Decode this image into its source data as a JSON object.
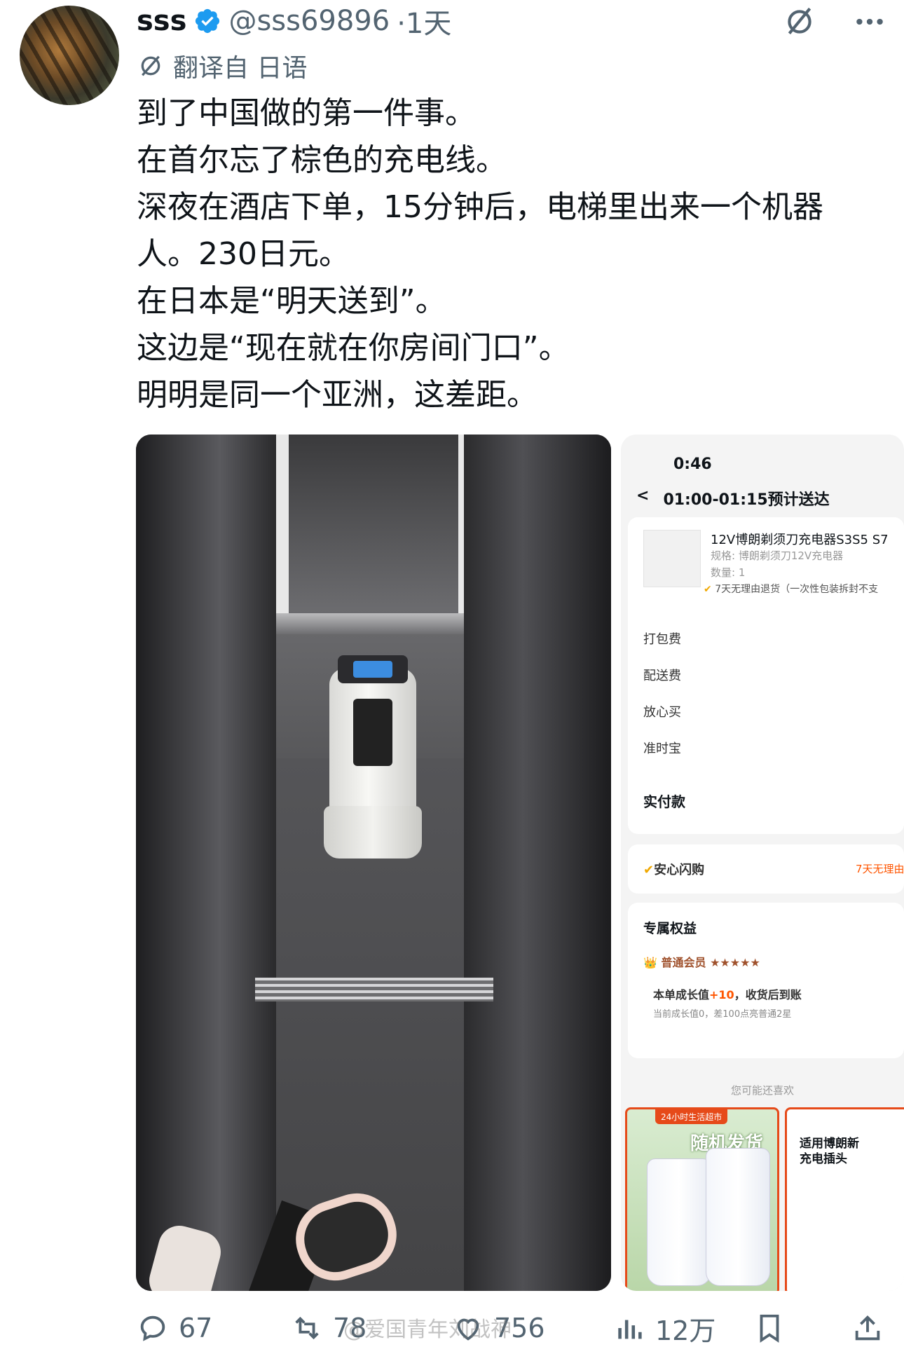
{
  "author": {
    "display_name": "sss",
    "handle": "@sss69896",
    "time": "·1天",
    "verified_icon": "verified-badge-icon"
  },
  "translation_note": "翻译自 日语",
  "tweet_lines": [
    "到了中国做的第一件事。",
    "在首尔忘了棕色的充电线。",
    "深夜在酒店下单，15分钟后，电梯里出来一个机器",
    "人。230日元。",
    "在日本是“明天送到”。",
    "这边是“现在就在你房间门口”。",
    "明明是同一个亚洲，这差距。"
  ],
  "phone": {
    "time": "0:46",
    "eta": "01:00-01:15预计送达",
    "product_title": "12V博朗剃须刀充电器S3S5 S7",
    "product_spec": "规格: 博朗剃须刀12V充电器",
    "product_qty": "数量: 1",
    "return_policy": "7天无理由退货（一次性包装拆封不支",
    "fees": [
      "打包费",
      "配送费",
      "放心买",
      "准时宝"
    ],
    "paid_label": "实付款",
    "safe_buy": "安心闪购",
    "safe_buy_note": "7天无理由",
    "perks_title": "专属权益",
    "member_level": "普通会员",
    "growth_prefix": "本单成长值",
    "growth_value": "+10",
    "growth_suffix": "，收货后到账",
    "growth_note": "当前成长值0，差100点亮普通2星",
    "recommend": "您可能还喜欢",
    "promo1_banner": "24小时生活超市",
    "promo1_title": "随机发货",
    "promo2_title": "适用博朗新\n充电插头"
  },
  "actions": {
    "replies": "67",
    "retweets": "78",
    "likes": "756",
    "views": "12万"
  },
  "watermark": "@爱国青年刘战神",
  "colors": {
    "accent_blue": "#1d9bf0",
    "text_secondary": "#536471",
    "promo_orange": "#ff5500"
  }
}
